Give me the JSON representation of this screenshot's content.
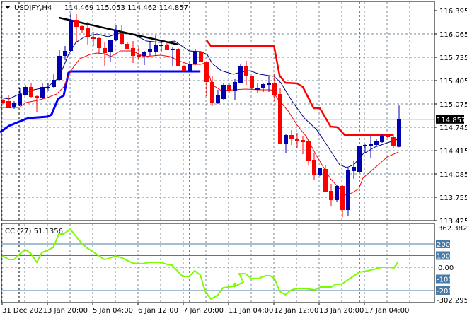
{
  "header": {
    "symbol": "USDJPY,H4",
    "ohlc": "114.469 115.053 114.462 114.857"
  },
  "cci_label": "CCI(27) 51.1356",
  "colors": {
    "bull": "#0000B0",
    "bear": "#FF0000",
    "ma_fast": "#000080",
    "ma_slow": "#FF0000",
    "support": "#0000FF",
    "resistance": "#FF0000",
    "trend": "#000000",
    "cci": "#7CFC00",
    "level_box": "#4A7BA7",
    "price_box": "#000000"
  },
  "price_axis": [
    "116.395",
    "116.065",
    "115.735",
    "115.405",
    "115.075",
    "114.745",
    "114.415",
    "114.085",
    "113.755",
    "113.425"
  ],
  "current_price": "114.857",
  "cci_axis": {
    "max": "362.3828",
    "min": "-302.2957",
    "zero": "0.00",
    "levels": [
      "200",
      "100",
      "-100",
      "-200"
    ]
  },
  "time_axis": [
    "31 Dec 2021",
    "3 Jan 20:00",
    "5 Jan 04:00",
    "6 Jan 12:00",
    "7 Jan 20:00",
    "11 Jan 04:00",
    "12 Jan 12:00",
    "13 Jan 20:00",
    "17 Jan 04:00"
  ],
  "chart_data": {
    "type": "candlestick",
    "candles_ohlc": [
      [
        115.125,
        115.145,
        115.075,
        115.095
      ],
      [
        115.115,
        115.195,
        115.015,
        115.015
      ],
      [
        115.025,
        115.115,
        115.005,
        115.095
      ],
      [
        115.055,
        115.295,
        115.045,
        115.215
      ],
      [
        115.205,
        115.345,
        115.195,
        115.315
      ],
      [
        115.315,
        115.365,
        115.155,
        115.175
      ],
      [
        115.185,
        115.195,
        114.955,
        115.155
      ],
      [
        115.155,
        115.375,
        115.145,
        115.315
      ],
      [
        115.305,
        115.365,
        115.255,
        115.315
      ],
      [
        115.315,
        115.495,
        115.305,
        115.415
      ],
      [
        115.415,
        115.835,
        115.405,
        115.755
      ],
      [
        115.755,
        115.895,
        115.695,
        115.825
      ],
      [
        115.825,
        116.355,
        115.815,
        116.265
      ],
      [
        116.265,
        116.345,
        115.955,
        116.165
      ],
      [
        116.175,
        116.195,
        116.075,
        116.115
      ],
      [
        116.145,
        116.235,
        115.915,
        116.015
      ],
      [
        116.015,
        116.095,
        115.895,
        116.005
      ],
      [
        116.005,
        116.025,
        115.775,
        115.865
      ],
      [
        115.865,
        115.955,
        115.615,
        115.795
      ],
      [
        115.805,
        115.975,
        115.675,
        115.975
      ],
      [
        115.975,
        116.195,
        115.965,
        116.115
      ],
      [
        116.085,
        116.195,
        115.915,
        115.925
      ],
      [
        115.925,
        115.945,
        115.845,
        115.855
      ],
      [
        115.865,
        115.965,
        115.655,
        115.755
      ],
      [
        115.765,
        115.875,
        115.695,
        115.755
      ],
      [
        115.755,
        115.825,
        115.625,
        115.815
      ],
      [
        115.815,
        115.965,
        115.755,
        115.855
      ],
      [
        115.815,
        116.055,
        115.755,
        115.905
      ],
      [
        115.905,
        115.945,
        115.815,
        115.915
      ],
      [
        115.915,
        115.955,
        115.835,
        115.835
      ],
      [
        115.845,
        115.885,
        115.615,
        115.855
      ],
      [
        115.855,
        115.865,
        115.605,
        115.615
      ],
      [
        115.615,
        115.625,
        115.535,
        115.545
      ],
      [
        115.545,
        115.685,
        115.535,
        115.645
      ],
      [
        115.635,
        115.855,
        115.625,
        115.815
      ],
      [
        115.815,
        115.825,
        115.665,
        115.675
      ],
      [
        115.675,
        115.685,
        115.185,
        115.385
      ],
      [
        115.385,
        115.465,
        115.045,
        115.085
      ],
      [
        115.085,
        115.275,
        115.075,
        115.205
      ],
      [
        115.145,
        115.365,
        115.135,
        115.345
      ],
      [
        115.345,
        115.365,
        115.225,
        115.265
      ],
      [
        115.265,
        115.425,
        115.125,
        115.385
      ],
      [
        115.375,
        115.645,
        115.365,
        115.615
      ],
      [
        115.615,
        115.685,
        115.345,
        115.465
      ],
      [
        115.465,
        115.475,
        115.285,
        115.295
      ],
      [
        115.285,
        115.365,
        115.235,
        115.295
      ],
      [
        115.295,
        115.365,
        115.245,
        115.355
      ],
      [
        115.355,
        115.465,
        115.245,
        115.365
      ],
      [
        115.365,
        115.495,
        115.115,
        115.205
      ],
      [
        115.215,
        115.295,
        114.505,
        114.515
      ],
      [
        114.515,
        114.655,
        114.375,
        114.635
      ],
      [
        114.635,
        114.705,
        114.495,
        114.575
      ],
      [
        114.575,
        114.665,
        114.455,
        114.565
      ],
      [
        114.565,
        114.615,
        114.365,
        114.535
      ],
      [
        114.545,
        114.555,
        114.215,
        114.275
      ],
      [
        114.285,
        114.375,
        114.0,
        114.065
      ],
      [
        114.065,
        114.175,
        114.055,
        114.165
      ],
      [
        114.155,
        114.215,
        113.825,
        113.835
      ],
      [
        113.845,
        113.945,
        113.635,
        113.715
      ],
      [
        113.715,
        113.925,
        113.695,
        113.915
      ],
      [
        113.915,
        113.925,
        113.475,
        113.575
      ],
      [
        113.575,
        114.175,
        113.495,
        114.135
      ],
      [
        114.125,
        114.275,
        114.015,
        114.185
      ],
      [
        114.115,
        114.485,
        114.105,
        114.475
      ],
      [
        114.475,
        114.515,
        114.385,
        114.495
      ],
      [
        114.495,
        114.625,
        114.315,
        114.505
      ],
      [
        114.495,
        114.575,
        114.485,
        114.545
      ],
      [
        114.535,
        114.655,
        114.525,
        114.625
      ],
      [
        114.625,
        114.645,
        114.595,
        114.605
      ],
      [
        114.605,
        114.615,
        114.445,
        114.475
      ],
      [
        114.469,
        115.053,
        114.462,
        114.857
      ]
    ],
    "ma_fast": [
      [
        -0.5,
        115.165
      ],
      [
        1.1,
        115.145
      ],
      [
        2.9,
        115.215
      ],
      [
        4.9,
        115.265
      ],
      [
        7.9,
        115.315
      ],
      [
        9.9,
        115.445
      ],
      [
        11.6,
        115.775
      ],
      [
        12.9,
        115.945
      ],
      [
        14.5,
        116.025
      ],
      [
        16.6,
        116.065
      ],
      [
        18.6,
        116.025
      ],
      [
        20.4,
        116.075
      ],
      [
        22.9,
        116.065
      ],
      [
        25.4,
        115.965
      ],
      [
        27.9,
        115.945
      ],
      [
        30.4,
        115.965
      ],
      [
        31.6,
        115.895
      ],
      [
        32.9,
        115.825
      ],
      [
        34.9,
        115.815
      ],
      [
        36.1,
        115.775
      ],
      [
        37,
        115.645
      ],
      [
        38.6,
        115.545
      ],
      [
        40.75,
        115.495
      ],
      [
        42,
        115.525
      ],
      [
        43.6,
        115.545
      ],
      [
        45.4,
        115.495
      ],
      [
        47.9,
        115.465
      ],
      [
        49.1,
        115.375
      ],
      [
        51.1,
        115.115
      ],
      [
        53.25,
        114.875
      ],
      [
        55.4,
        114.715
      ],
      [
        57.4,
        114.475
      ],
      [
        59.5,
        114.215
      ],
      [
        60.75,
        114.175
      ],
      [
        62,
        114.215
      ],
      [
        63.6,
        114.365
      ],
      [
        65.75,
        114.465
      ],
      [
        67.9,
        114.525
      ],
      [
        69.5,
        114.565
      ],
      [
        70,
        114.62
      ]
    ],
    "ma_slow": [
      [
        -0.5,
        115.025
      ],
      [
        2.9,
        115.025
      ],
      [
        4.1,
        115.095
      ],
      [
        6.1,
        115.125
      ],
      [
        7.9,
        115.165
      ],
      [
        9.5,
        115.215
      ],
      [
        10.75,
        115.315
      ],
      [
        12,
        115.545
      ],
      [
        13.6,
        115.715
      ],
      [
        15.4,
        115.775
      ],
      [
        16.6,
        115.795
      ],
      [
        17.9,
        115.785
      ],
      [
        19.1,
        115.745
      ],
      [
        20.75,
        115.825
      ],
      [
        22.9,
        115.825
      ],
      [
        24.9,
        115.745
      ],
      [
        27.9,
        115.765
      ],
      [
        29.5,
        115.745
      ],
      [
        31.1,
        115.685
      ],
      [
        32.9,
        115.635
      ],
      [
        34.9,
        115.635
      ],
      [
        35.75,
        115.655
      ],
      [
        37,
        115.345
      ],
      [
        38.6,
        115.265
      ],
      [
        40.75,
        115.275
      ],
      [
        42.9,
        115.285
      ],
      [
        45.4,
        115.275
      ],
      [
        47.4,
        115.275
      ],
      [
        48.6,
        115.145
      ],
      [
        50.4,
        114.975
      ],
      [
        52,
        114.775
      ],
      [
        53.6,
        114.615
      ],
      [
        55.4,
        114.345
      ],
      [
        57.9,
        114.015
      ],
      [
        59.5,
        113.875
      ],
      [
        60.75,
        113.775
      ],
      [
        62.9,
        113.875
      ],
      [
        63.6,
        114.025
      ],
      [
        65.75,
        114.175
      ],
      [
        67.9,
        114.325
      ],
      [
        69.9,
        114.395
      ]
    ],
    "support_line": [
      [
        -0.5,
        114.675
      ],
      [
        1.1,
        114.765
      ],
      [
        2.9,
        114.825
      ],
      [
        4.5,
        114.875
      ],
      [
        7.9,
        114.895
      ],
      [
        8.6,
        114.925
      ],
      [
        9.75,
        115.145
      ],
      [
        10.75,
        115.195
      ],
      [
        11.6,
        115.515
      ],
      [
        12,
        115.535
      ],
      [
        34.9,
        115.535
      ]
    ],
    "resistance_line": [
      [
        36,
        115.975
      ],
      [
        36.75,
        115.895
      ],
      [
        47.9,
        115.895
      ],
      [
        48.9,
        115.475
      ],
      [
        49.9,
        115.375
      ],
      [
        52,
        115.365
      ],
      [
        53,
        115.315
      ],
      [
        54.9,
        115.015
      ],
      [
        56,
        115.015
      ],
      [
        57.9,
        114.755
      ],
      [
        59.1,
        114.745
      ],
      [
        60.4,
        114.635
      ],
      [
        68.9,
        114.635
      ],
      [
        68.9,
        114.615
      ]
    ],
    "trendline": [
      [
        9.9,
        116.295
      ],
      [
        31,
        115.915
      ]
    ],
    "cci": [
      [
        -0.1,
        97
      ],
      [
        1.1,
        67
      ],
      [
        2,
        67
      ],
      [
        2.9,
        109
      ],
      [
        3.9,
        152
      ],
      [
        4.9,
        121
      ],
      [
        6,
        42
      ],
      [
        6.9,
        127
      ],
      [
        7.9,
        145
      ],
      [
        8.9,
        170
      ],
      [
        9.9,
        285
      ],
      [
        10.75,
        285
      ],
      [
        11.9,
        327
      ],
      [
        13.6,
        224
      ],
      [
        14.9,
        164
      ],
      [
        16.1,
        127
      ],
      [
        17.9,
        67
      ],
      [
        18.6,
        73
      ],
      [
        19.9,
        97
      ],
      [
        21.1,
        79
      ],
      [
        22.9,
        36
      ],
      [
        24.5,
        30
      ],
      [
        26,
        42
      ],
      [
        27.9,
        42
      ],
      [
        29.1,
        24
      ],
      [
        29.9,
        18
      ],
      [
        31.75,
        -79
      ],
      [
        32.9,
        -79
      ],
      [
        33.9,
        -30
      ],
      [
        34.9,
        -67
      ],
      [
        35.75,
        -206
      ],
      [
        36.75,
        -273
      ],
      [
        37.9,
        -242
      ],
      [
        38.9,
        -176
      ],
      [
        40.75,
        -164
      ],
      [
        41,
        -133
      ],
      [
        41.0,
        -164
      ],
      [
        42.5,
        -127
      ],
      [
        41.75,
        -55
      ],
      [
        42.9,
        -55
      ],
      [
        43.9,
        -97
      ],
      [
        45.1,
        -97
      ],
      [
        46.4,
        -73
      ],
      [
        47.25,
        -73
      ],
      [
        48,
        -97
      ],
      [
        48.9,
        -206
      ],
      [
        49.9,
        -236
      ],
      [
        51,
        -194
      ],
      [
        52,
        -182
      ],
      [
        53.25,
        -182
      ],
      [
        55.1,
        -194
      ],
      [
        56.1,
        -170
      ],
      [
        58,
        -170
      ],
      [
        58.9,
        -145
      ],
      [
        59.9,
        -145
      ],
      [
        61.1,
        -103
      ],
      [
        63,
        -42
      ],
      [
        64.5,
        -30
      ],
      [
        67,
        0
      ],
      [
        68.25,
        0
      ],
      [
        69.1,
        -6
      ],
      [
        69.9,
        51.1356
      ]
    ],
    "price_range": [
      113.425,
      116.395
    ],
    "cci_range": [
      -302.2957,
      362.3828
    ],
    "cci_levels": [
      200,
      100,
      0,
      -100,
      -200
    ]
  }
}
